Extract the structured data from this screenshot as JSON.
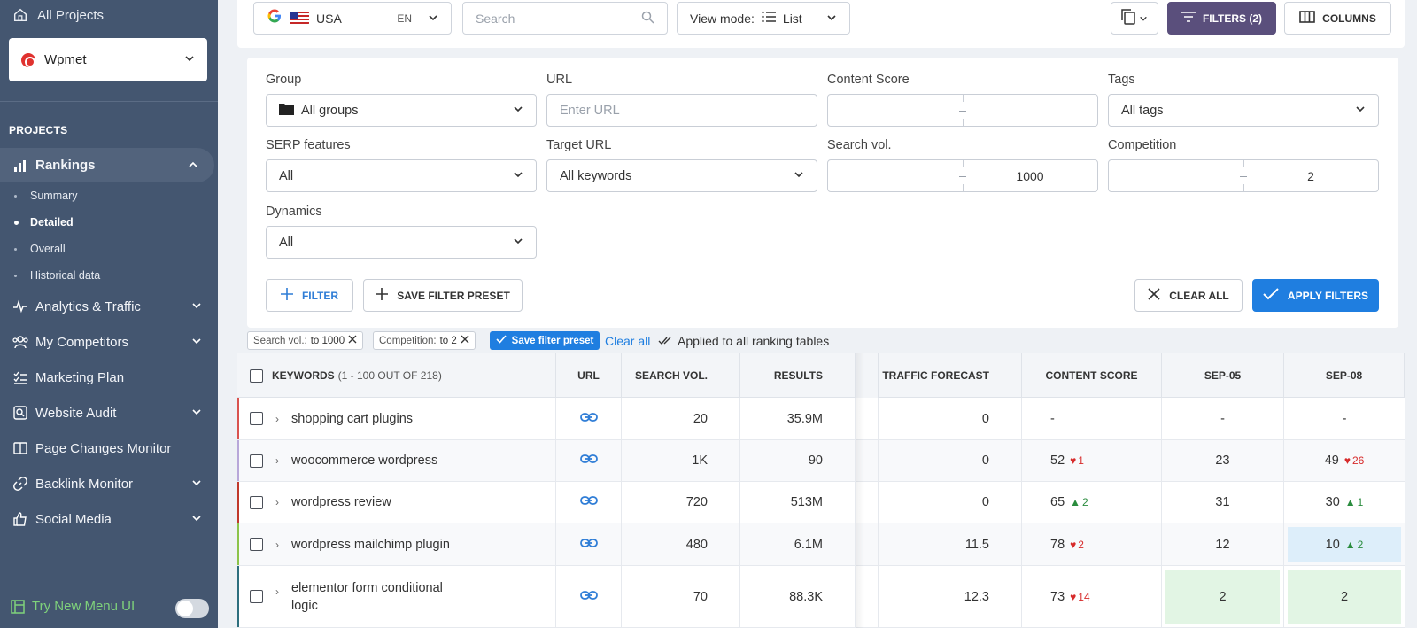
{
  "sidebar": {
    "all_projects": "All Projects",
    "project": "Wpmet",
    "heading": "PROJECTS",
    "nav": [
      {
        "label": "Rankings"
      },
      {
        "label": "Analytics & Traffic"
      },
      {
        "label": "My Competitors"
      },
      {
        "label": "Marketing Plan"
      },
      {
        "label": "Website Audit"
      },
      {
        "label": "Page Changes Monitor"
      },
      {
        "label": "Backlink Monitor"
      },
      {
        "label": "Social Media"
      }
    ],
    "rankings_sub": [
      "Summary",
      "Detailed",
      "Overall",
      "Historical data"
    ],
    "try_new": "Try New Menu UI"
  },
  "topbar": {
    "country": "USA",
    "lang": "EN",
    "search_placeholder": "Search",
    "view_mode_label": "View mode:",
    "view_mode_value": "List",
    "filters_button": "FILTERS (2)",
    "columns_button": "COLUMNS"
  },
  "filters": {
    "group_label": "Group",
    "group_value": "All groups",
    "url_label": "URL",
    "url_placeholder": "Enter URL",
    "content_score_label": "Content Score",
    "tags_label": "Tags",
    "tags_value": "All tags",
    "serp_label": "SERP features",
    "serp_value": "All",
    "target_url_label": "Target URL",
    "target_url_value": "All keywords",
    "search_vol_label": "Search vol.",
    "search_vol_to": "1000",
    "competition_label": "Competition",
    "competition_to": "2",
    "dynamics_label": "Dynamics",
    "dynamics_value": "All",
    "filter_button": "FILTER",
    "save_preset_button": "SAVE FILTER PRESET",
    "clear_all_button": "CLEAR ALL",
    "apply_button": "APPLY FILTERS"
  },
  "chips": [
    {
      "key": "Search vol.:",
      "value": "to 1000"
    },
    {
      "key": "Competition:",
      "value": "to 2"
    }
  ],
  "chips_save": "Save filter preset",
  "chips_clear": "Clear all",
  "applied_note": "Applied to all ranking tables",
  "table": {
    "headers": {
      "keywords": "KEYWORDS",
      "keywords_count": "(1 - 100 OUT OF 218)",
      "url": "URL",
      "search_vol": "SEARCH VOL.",
      "results": "RESULTS",
      "traffic": "TRAFFIC FORECAST",
      "content_score": "CONTENT SCORE",
      "sep05": "SEP-05",
      "sep08": "SEP-08"
    },
    "rows": [
      {
        "keyword": "shopping cart plugins",
        "vol": "20",
        "results": "35.9M",
        "traffic": "0",
        "cs": "-",
        "cs_delta": "",
        "s05": "-",
        "s08": "-",
        "s08_delta": "",
        "bar": "#d9534f"
      },
      {
        "keyword": "woocommerce wordpress",
        "vol": "1K",
        "results": "90",
        "traffic": "0",
        "cs": "52",
        "cs_delta": "1",
        "s05": "23",
        "s08": "49",
        "s08_delta": "26",
        "bar": "#b8a7d9"
      },
      {
        "keyword": "wordpress review",
        "vol": "720",
        "results": "513M",
        "traffic": "0",
        "cs": "65",
        "cs_delta": "2",
        "s05": "31",
        "s08": "30",
        "s08_delta": "1",
        "bar": "#c0392b"
      },
      {
        "keyword": "wordpress mailchimp plugin",
        "vol": "480",
        "results": "6.1M",
        "traffic": "11.5",
        "cs": "78",
        "cs_delta": "2",
        "s05": "12",
        "s08": "10",
        "s08_delta": "2",
        "bar": "#8bc34a"
      },
      {
        "keyword_line1": "elementor form conditional",
        "keyword_line2": "logic",
        "vol": "70",
        "results": "88.3K",
        "traffic": "12.3",
        "cs": "73",
        "cs_delta": "14",
        "s05": "2",
        "s08": "2",
        "s08_delta": "",
        "bar": "#2e6f7e"
      }
    ]
  }
}
